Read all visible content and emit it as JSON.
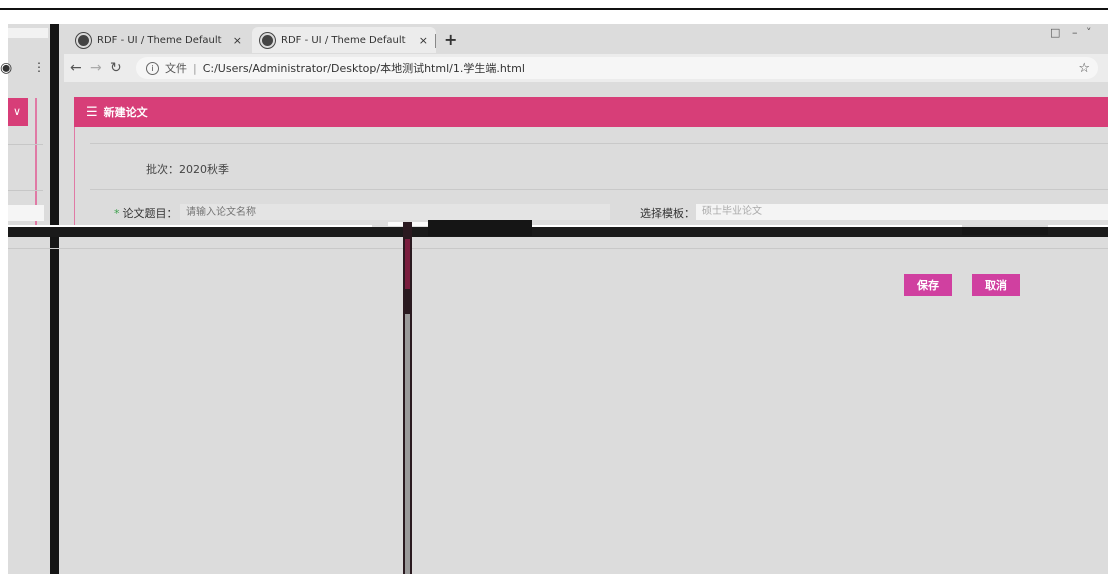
{
  "browser": {
    "tabs": [
      {
        "title": "RDF - UI / Theme Default"
      },
      {
        "title": "RDF - UI / Theme Default"
      }
    ],
    "new_tab_symbol": "+",
    "tab_close_symbol": "×",
    "address": {
      "scheme_label": "文件",
      "url": "C:/Users/Administrator/Desktop/本地测试html/1.学生端.html"
    }
  },
  "page": {
    "header_title": "新建论文",
    "batch_label": "批次：",
    "batch_value": "2020秋季",
    "title_label": "论文题目：",
    "title_placeholder": "请输入论文名称",
    "template_label": "选择模板：",
    "template_value": "硕士毕业论文",
    "save_label": "保存",
    "cancel_label": "取消"
  },
  "colors": {
    "brand": "#d73e78",
    "button": "#d040a0",
    "required_mark": "#3aa04a"
  }
}
